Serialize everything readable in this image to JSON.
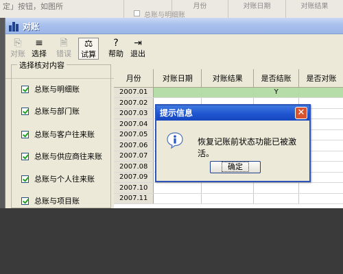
{
  "background_page": {
    "caption": "定」按钮，如图所",
    "checkbox_label": "总账与明细账",
    "table_headers": [
      "",
      "月份",
      "对账日期",
      "对账结果"
    ]
  },
  "window": {
    "title": "对账",
    "toolbar": [
      {
        "label": "对账",
        "icon": "reconcile-icon",
        "state": "disabled"
      },
      {
        "label": "选择",
        "icon": "select-list-icon",
        "state": "normal"
      },
      {
        "label": "错误",
        "icon": "error-doc-icon",
        "state": "disabled"
      },
      {
        "label": "试算",
        "icon": "balance-scale-icon",
        "state": "pressed"
      },
      {
        "label": "帮助",
        "icon": "help-icon",
        "state": "normal"
      },
      {
        "label": "退出",
        "icon": "exit-door-icon",
        "state": "normal"
      }
    ],
    "group_title": "选择核对内容",
    "checks": [
      {
        "label": "总账与明细账",
        "checked": true
      },
      {
        "label": "总账与部门账",
        "checked": true
      },
      {
        "label": "总账与客户往来账",
        "checked": true
      },
      {
        "label": "总账与供应商往来账",
        "checked": true
      },
      {
        "label": "总账与个人往来账",
        "checked": true
      },
      {
        "label": "总账与项目账",
        "checked": true
      }
    ],
    "grid": {
      "headers": [
        "月份",
        "对账日期",
        "对账结果",
        "是否结账",
        "是否对账"
      ],
      "rows": [
        {
          "month": "2007.01",
          "date": "",
          "result": "",
          "closed": "Y",
          "checked": ""
        },
        {
          "month": "2007.02",
          "date": "",
          "result": "",
          "closed": "",
          "checked": ""
        },
        {
          "month": "2007.03",
          "date": "",
          "result": "",
          "closed": "",
          "checked": ""
        },
        {
          "month": "2007.04",
          "date": "",
          "result": "",
          "closed": "",
          "checked": ""
        },
        {
          "month": "2007.05",
          "date": "",
          "result": "",
          "closed": "",
          "checked": ""
        },
        {
          "month": "2007.06",
          "date": "",
          "result": "",
          "closed": "",
          "checked": ""
        },
        {
          "month": "2007.07",
          "date": "",
          "result": "",
          "closed": "",
          "checked": ""
        },
        {
          "month": "2007.08",
          "date": "",
          "result": "",
          "closed": "",
          "checked": ""
        },
        {
          "month": "2007.09",
          "date": "",
          "result": "",
          "closed": "",
          "checked": ""
        },
        {
          "month": "2007.10",
          "date": "",
          "result": "",
          "closed": "",
          "checked": ""
        },
        {
          "month": "2007.11",
          "date": "",
          "result": "",
          "closed": "",
          "checked": ""
        }
      ]
    }
  },
  "dialog": {
    "title": "提示信息",
    "message": "恢复记账前状态功能已被激活。",
    "ok_label": "确定",
    "close_glyph": "✕"
  },
  "colors": {
    "titlebar": "#9cb6e6",
    "dialog_titlebar": "#2055d0",
    "selected_row": "#b6dca8",
    "close_button": "#d9542e"
  }
}
